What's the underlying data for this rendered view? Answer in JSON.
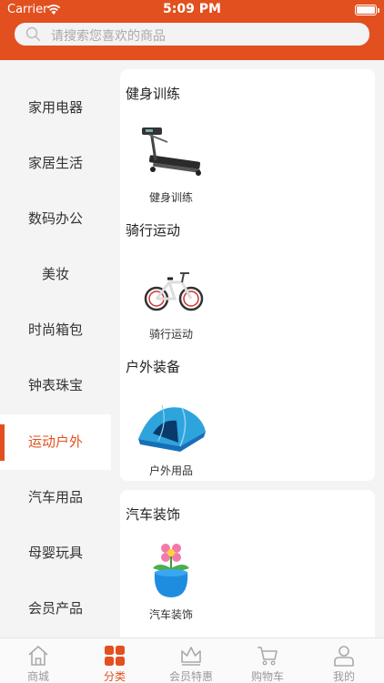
{
  "status_bar": {
    "carrier": "Carrier",
    "time": "5:09 PM"
  },
  "search": {
    "placeholder": "请搜索您喜欢的商品"
  },
  "sidebar": {
    "items": [
      {
        "label": "家用电器"
      },
      {
        "label": "家居生活"
      },
      {
        "label": "数码办公"
      },
      {
        "label": "美妆"
      },
      {
        "label": "时尚箱包"
      },
      {
        "label": "钟表珠宝"
      },
      {
        "label": "运动户外"
      },
      {
        "label": "汽车用品"
      },
      {
        "label": "母婴玩具"
      },
      {
        "label": "会员产品"
      }
    ],
    "active_index": 6
  },
  "content": {
    "cards": [
      {
        "sections": [
          {
            "title": "健身训练",
            "product": {
              "label": "健身训练",
              "icon": "treadmill-image"
            }
          },
          {
            "title": "骑行运动",
            "product": {
              "label": "骑行运动",
              "icon": "bicycle-image"
            }
          },
          {
            "title": "户外装备",
            "product": {
              "label": "户外用品",
              "icon": "tent-image"
            }
          }
        ]
      },
      {
        "sections": [
          {
            "title": "汽车装饰",
            "product": {
              "label": "汽车装饰",
              "icon": "flower-pot-image"
            }
          }
        ]
      }
    ]
  },
  "tabbar": {
    "tabs": [
      {
        "label": "商城",
        "icon": "home-icon"
      },
      {
        "label": "分类",
        "icon": "category-grid-icon"
      },
      {
        "label": "会员特惠",
        "icon": "crown-icon"
      },
      {
        "label": "购物车",
        "icon": "cart-icon"
      },
      {
        "label": "我的",
        "icon": "user-icon"
      }
    ],
    "active_index": 1
  },
  "colors": {
    "accent": "#e2501f",
    "background": "#f4f4f4",
    "inactive": "#999999"
  }
}
